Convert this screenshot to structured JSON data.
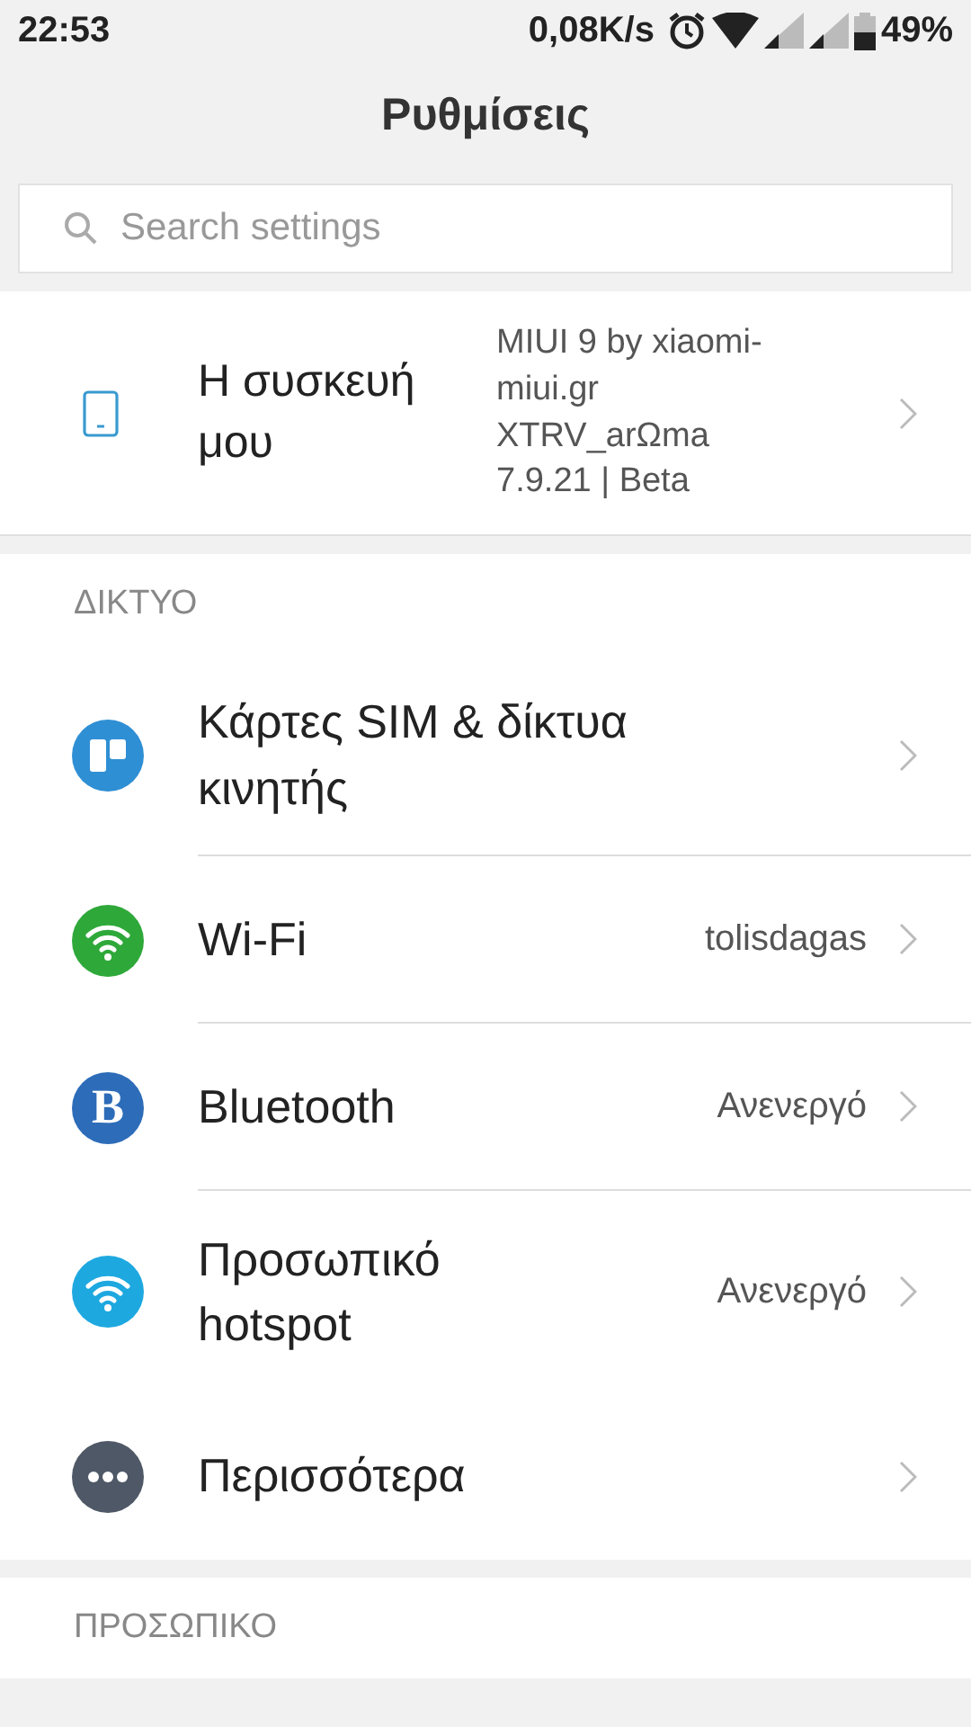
{
  "status_bar": {
    "time": "22:53",
    "speed": "0,08K/s",
    "battery": "49%"
  },
  "title": "Ρυθμίσεις",
  "search": {
    "placeholder": "Search settings"
  },
  "device": {
    "label": "Η συσκευή μου",
    "detail": "MIUI 9 by xiaomi-miui.gr XTRV_arΩma 7.9.21 | Beta"
  },
  "sections": [
    {
      "header": "ΔΙΚΤΥΟ",
      "items": [
        {
          "kind": "sim",
          "label": "Κάρτες SIM & δίκτυα κινητής",
          "divider_below": true
        },
        {
          "kind": "wifi",
          "label": "Wi-Fi",
          "value": "tolisdagas",
          "divider_below": true
        },
        {
          "kind": "bluetooth",
          "glyph": "B",
          "label": "Bluetooth",
          "value": "Ανενεργό",
          "divider_below": true
        },
        {
          "kind": "hotspot",
          "label": "Προσωπικό hotspot",
          "value": "Ανενεργό",
          "divider_below": false
        },
        {
          "kind": "more",
          "label": "Περισσότερα",
          "divider_below": false
        }
      ]
    },
    {
      "header": "ΠΡΟΣΩΠΙΚΟ"
    }
  ]
}
